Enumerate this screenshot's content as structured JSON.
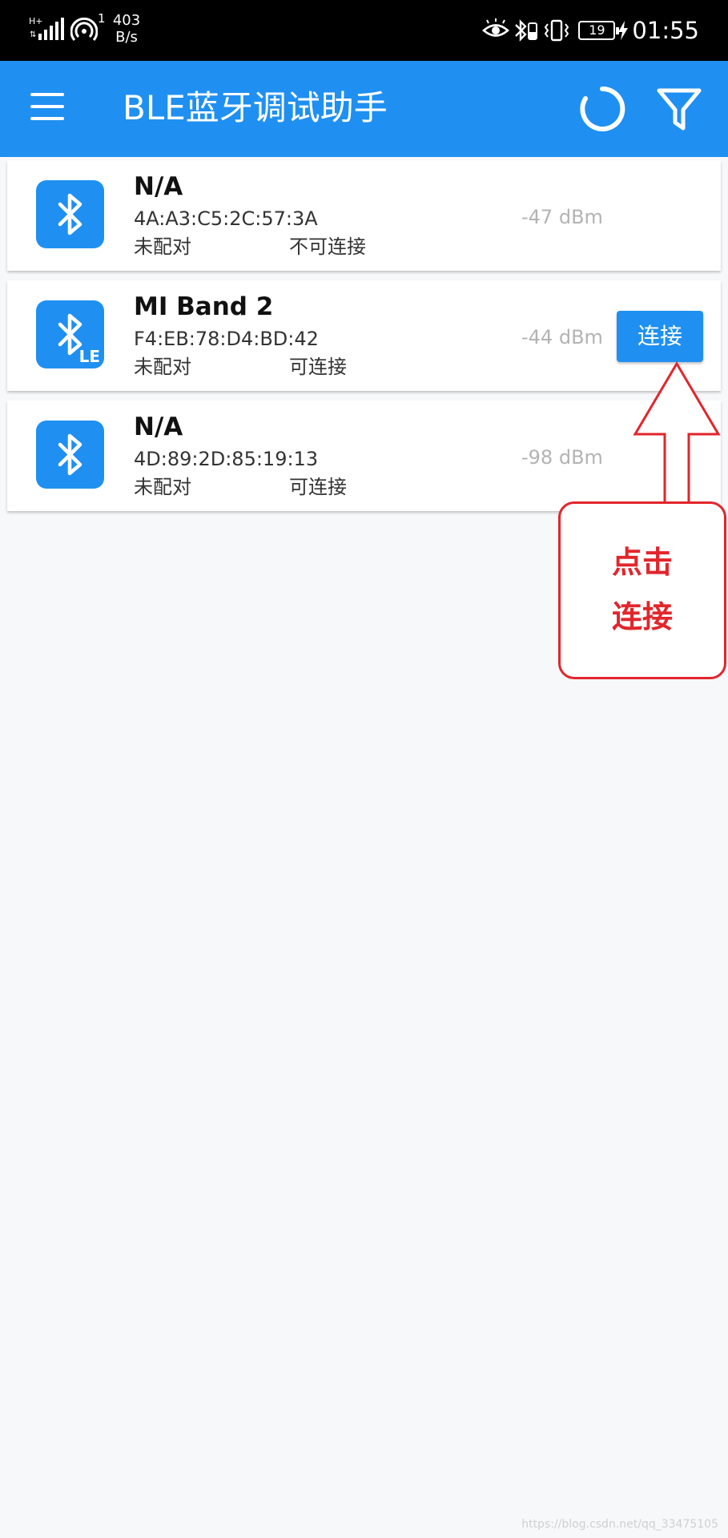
{
  "status_bar": {
    "network_badge": "1",
    "speed_value": "403",
    "speed_unit": "B/s",
    "battery": "19",
    "time": "01:55",
    "icons": [
      "signal-icon",
      "hotspot-icon",
      "eye-comfort-icon",
      "bluetooth-battery-icon",
      "vibrate-icon",
      "battery-icon",
      "charging-icon"
    ]
  },
  "app_bar": {
    "title": "BLE蓝牙调试助手",
    "icons": [
      "menu-icon",
      "refresh-icon",
      "filter-icon"
    ]
  },
  "devices": [
    {
      "name": "N/A",
      "mac": "4A:A3:C5:2C:57:3A",
      "bond_state": "未配对",
      "connectable": "不可连接",
      "rssi": "-47 dBm",
      "le_badge": "",
      "show_connect": false
    },
    {
      "name": "MI Band 2",
      "mac": "F4:EB:78:D4:BD:42",
      "bond_state": "未配对",
      "connectable": "可连接",
      "rssi": "-44 dBm",
      "le_badge": "LE",
      "show_connect": true,
      "connect_label": "连接"
    },
    {
      "name": "N/A",
      "mac": "4D:89:2D:85:19:13",
      "bond_state": "未配对",
      "connectable": "可连接",
      "rssi": "-98 dBm",
      "le_badge": "",
      "show_connect": false
    }
  ],
  "annotation": {
    "line1": "点击",
    "line2": "连接",
    "color": "#e1262c"
  },
  "colors": {
    "primary": "#1f90f1",
    "background": "#f7f8fa",
    "status_bar": "#000000"
  },
  "watermark": "https://blog.csdn.net/qq_33475105"
}
